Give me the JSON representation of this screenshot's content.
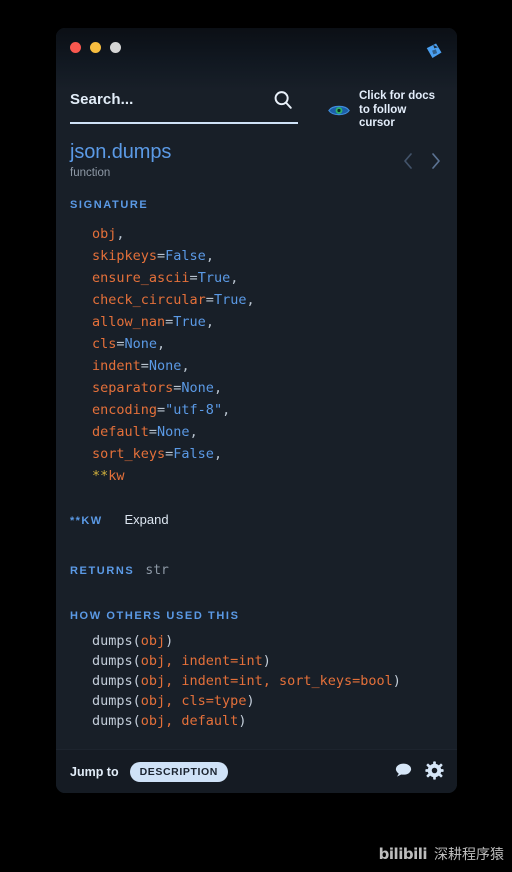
{
  "window": {
    "controls": [
      "close",
      "minimize",
      "maximize"
    ],
    "brand_logo": "kite-logo-icon"
  },
  "search": {
    "placeholder": "Search...",
    "value": "",
    "icon": "search-icon"
  },
  "docs_hint": {
    "icon": "eye-icon",
    "text": "Click for docs\nto follow cursor"
  },
  "header": {
    "title": "json.dumps",
    "kind": "function",
    "prev_icon": "chevron-left-icon",
    "next_icon": "chevron-right-icon"
  },
  "signature": {
    "label": "SIGNATURE",
    "params": [
      {
        "name": "obj",
        "op": "",
        "value": "",
        "trail": ","
      },
      {
        "name": "skipkeys",
        "op": "=",
        "value": "False",
        "trail": ","
      },
      {
        "name": "ensure_ascii",
        "op": "=",
        "value": "True",
        "trail": ","
      },
      {
        "name": "check_circular",
        "op": "=",
        "value": "True",
        "trail": ","
      },
      {
        "name": "allow_nan",
        "op": "=",
        "value": "True",
        "trail": ","
      },
      {
        "name": "cls",
        "op": "=",
        "value": "None",
        "trail": ","
      },
      {
        "name": "indent",
        "op": "=",
        "value": "None",
        "trail": ","
      },
      {
        "name": "separators",
        "op": "=",
        "value": "None",
        "trail": ","
      },
      {
        "name": "encoding",
        "op": "=",
        "value": "\"utf-8\"",
        "trail": ","
      },
      {
        "name": "default",
        "op": "=",
        "value": "None",
        "trail": ","
      },
      {
        "name": "sort_keys",
        "op": "=",
        "value": "False",
        "trail": ","
      },
      {
        "name": "**kw",
        "op": "",
        "value": "",
        "trail": ""
      }
    ]
  },
  "kwargs": {
    "label": "**KW",
    "expand_label": "Expand"
  },
  "returns": {
    "label": "RETURNS",
    "type": "str"
  },
  "usages": {
    "label": "HOW OTHERS USED THIS",
    "examples": [
      {
        "fn": "dumps",
        "args": "obj"
      },
      {
        "fn": "dumps",
        "args": "obj, indent=int"
      },
      {
        "fn": "dumps",
        "args": "obj, indent=int, sort_keys=bool"
      },
      {
        "fn": "dumps",
        "args": "obj, cls=type"
      },
      {
        "fn": "dumps",
        "args": "obj, default"
      }
    ]
  },
  "footer": {
    "jump_label": "Jump to",
    "jump_target": "DESCRIPTION",
    "chat_icon": "chat-bubble-icon",
    "settings_icon": "gear-icon"
  },
  "watermark": {
    "logo": "bilibili",
    "text": "深耕程序猿"
  },
  "colors": {
    "panel_bg": "#181f28",
    "accent_blue": "#5b9ae6",
    "param_orange": "#e4703a",
    "muted": "#8e99a6",
    "chip_bg": "#cfe2f7",
    "light_red": "#f9584f",
    "light_yellow": "#f7bd3f",
    "light_gray": "#d5d5d5"
  }
}
